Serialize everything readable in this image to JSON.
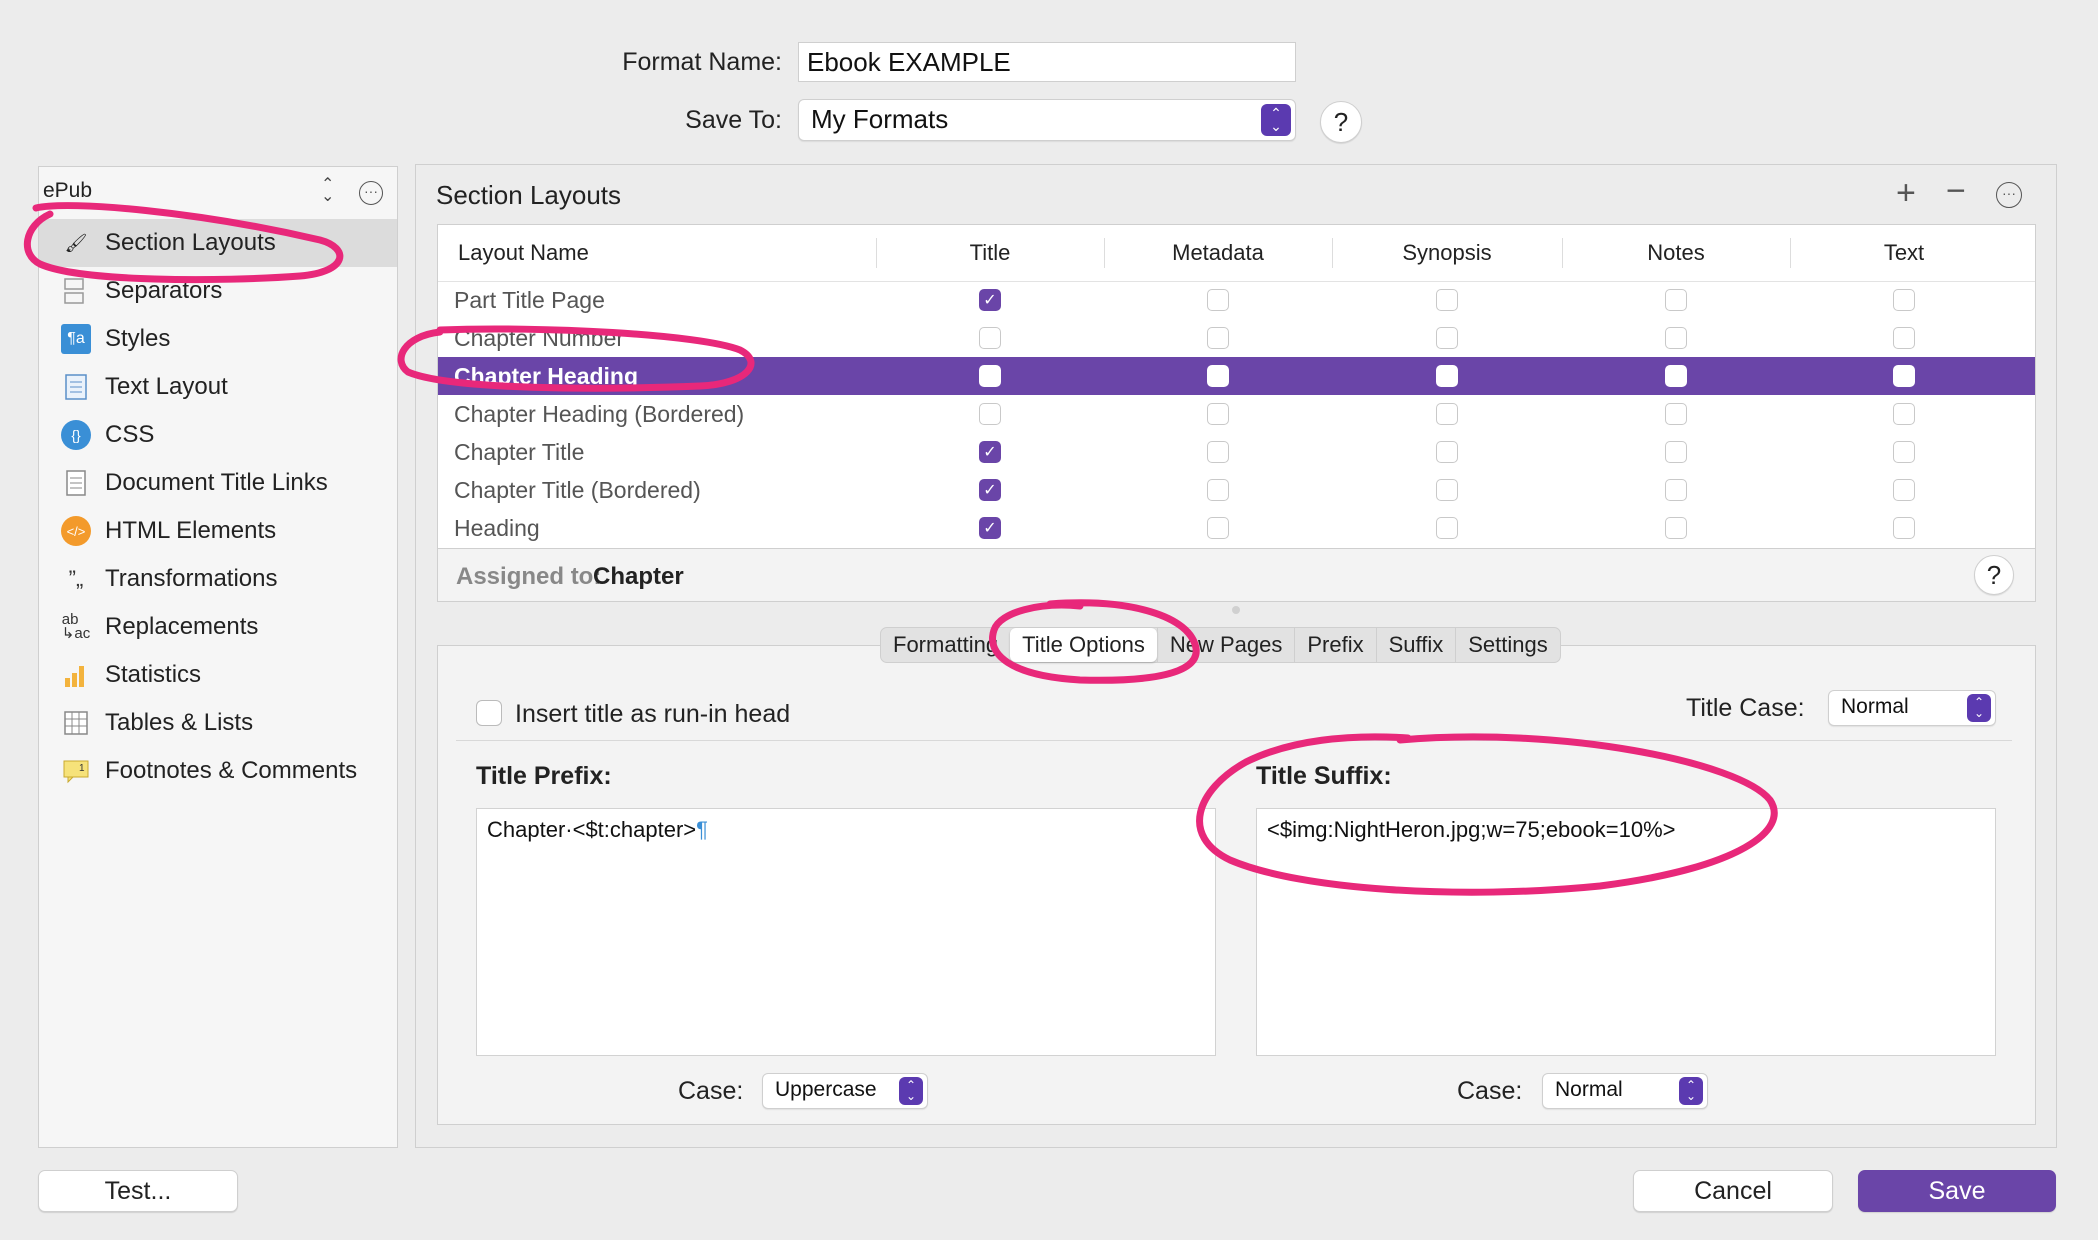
{
  "form": {
    "format_name_label": "Format Name:",
    "format_name_value": "Ebook EXAMPLE",
    "save_to_label": "Save To:",
    "save_to_value": "My Formats",
    "help": "?"
  },
  "sidebar": {
    "format": "ePub",
    "items": [
      {
        "label": "Section Layouts",
        "icon": "brush-icon"
      },
      {
        "label": "Separators",
        "icon": "separator-icon"
      },
      {
        "label": "Styles",
        "icon": "styles-icon"
      },
      {
        "label": "Text Layout",
        "icon": "text-layout-icon"
      },
      {
        "label": "CSS",
        "icon": "css-icon"
      },
      {
        "label": "Document Title Links",
        "icon": "document-icon"
      },
      {
        "label": "HTML Elements",
        "icon": "html-icon"
      },
      {
        "label": "Transformations",
        "icon": "quotes-icon"
      },
      {
        "label": "Replacements",
        "icon": "replace-icon"
      },
      {
        "label": "Statistics",
        "icon": "chart-icon"
      },
      {
        "label": "Tables & Lists",
        "icon": "table-icon"
      },
      {
        "label": "Footnotes & Comments",
        "icon": "footnote-icon"
      }
    ]
  },
  "section_layouts": {
    "title": "Section Layouts",
    "columns": [
      "Layout Name",
      "Title",
      "Metadata",
      "Synopsis",
      "Notes",
      "Text"
    ],
    "rows": [
      {
        "name": "Part Title Page",
        "checks": [
          true,
          false,
          false,
          false,
          false
        ]
      },
      {
        "name": "Chapter Number",
        "checks": [
          false,
          false,
          false,
          false,
          false
        ]
      },
      {
        "name": "Chapter Heading",
        "checks": [
          false,
          false,
          false,
          false,
          false
        ],
        "selected": true
      },
      {
        "name": "Chapter Heading (Bordered)",
        "checks": [
          false,
          false,
          false,
          false,
          false
        ]
      },
      {
        "name": "Chapter Title",
        "checks": [
          true,
          false,
          false,
          false,
          false
        ]
      },
      {
        "name": "Chapter Title (Bordered)",
        "checks": [
          true,
          false,
          false,
          false,
          false
        ]
      },
      {
        "name": "Heading",
        "checks": [
          true,
          false,
          false,
          false,
          false
        ]
      }
    ],
    "assigned_label": "Assigned to:",
    "assigned_value": "Chapter"
  },
  "tabs": [
    "Formatting",
    "Title Options",
    "New Pages",
    "Prefix",
    "Suffix",
    "Settings"
  ],
  "title_options": {
    "run_in_label": "Insert title as run-in head",
    "title_case_label": "Title Case:",
    "title_case_value": "Normal",
    "prefix_label": "Title Prefix:",
    "prefix_value": "Chapter·<$t:chapter>",
    "pilcrow": "¶",
    "suffix_label": "Title Suffix:",
    "suffix_value": "<$img:NightHeron.jpg;w=75;ebook=10%>",
    "case_label": "Case:",
    "prefix_case_value": "Uppercase",
    "suffix_case_value": "Normal"
  },
  "buttons": {
    "test": "Test...",
    "cancel": "Cancel",
    "save": "Save"
  },
  "colors": {
    "accent": "#6a45a8",
    "annotation": "#e8287a"
  }
}
